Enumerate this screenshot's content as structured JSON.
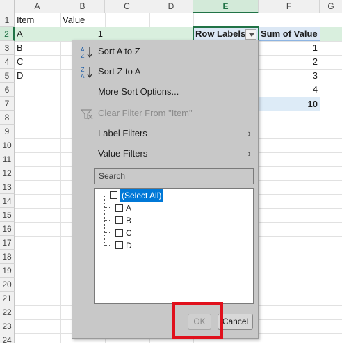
{
  "columns": [
    "A",
    "B",
    "C",
    "D",
    "E",
    "F",
    "G"
  ],
  "selected_column": "E",
  "rows": [
    "1",
    "2",
    "3",
    "4",
    "5",
    "6",
    "7",
    "8",
    "9",
    "10",
    "11",
    "12",
    "13",
    "14",
    "15",
    "16",
    "17",
    "18",
    "19",
    "20",
    "21",
    "22",
    "23",
    "24"
  ],
  "selected_row": "2",
  "data_table": {
    "header": [
      "Item",
      "Value"
    ],
    "rows": [
      {
        "item": "A",
        "value": "1"
      },
      {
        "item": "B",
        "value": ""
      },
      {
        "item": "C",
        "value": ""
      },
      {
        "item": "D",
        "value": ""
      }
    ]
  },
  "pivot": {
    "row_labels_header": "Row Labels",
    "sum_header": "Sum of Value",
    "values": [
      "1",
      "2",
      "3",
      "4"
    ],
    "total": "10"
  },
  "menu": {
    "sort_a_z": "Sort A to Z",
    "sort_z_a": "Sort Z to A",
    "more_sort": "More Sort Options...",
    "clear_filter": "Clear Filter From \"Item\"",
    "label_filters": "Label Filters",
    "value_filters": "Value Filters",
    "search_placeholder": "Search",
    "list": [
      "(Select All)",
      "A",
      "B",
      "C",
      "D"
    ],
    "ok": "OK",
    "cancel": "Cancel"
  },
  "colors": {
    "selection_green": "#217346",
    "pivot_blue": "#dbe7f4",
    "menu_bg": "#c8c8c8",
    "highlight_red": "#e0101c"
  }
}
